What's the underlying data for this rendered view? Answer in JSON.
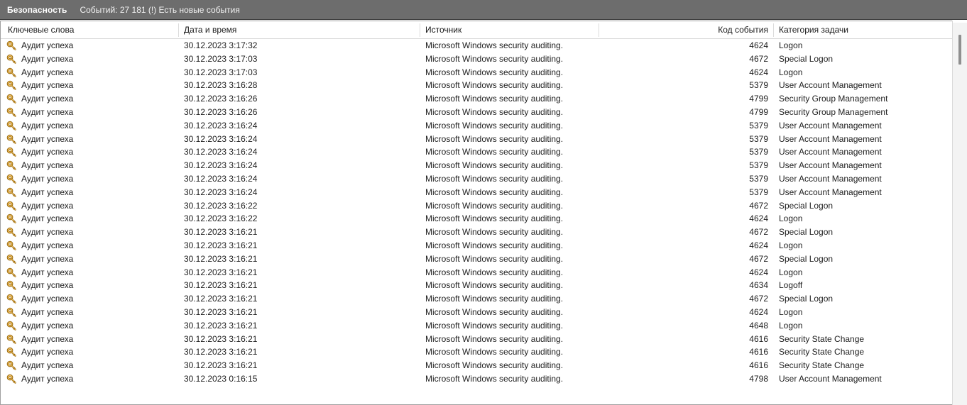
{
  "titlebar": {
    "log_name": "Безопасность",
    "status": "Событий: 27 181 (!) Есть новые события"
  },
  "columns": [
    {
      "key": "keywords",
      "label": "Ключевые слова",
      "align": "left"
    },
    {
      "key": "datetime",
      "label": "Дата и время",
      "align": "left"
    },
    {
      "key": "source",
      "label": "Источник",
      "align": "left"
    },
    {
      "key": "event_id",
      "label": "Код события",
      "align": "right"
    },
    {
      "key": "task_category",
      "label": "Категория задачи",
      "align": "left"
    }
  ],
  "icons": {
    "row_icon": "key-icon",
    "row_icon_color": "#e8a317"
  },
  "colors": {
    "titlebar_bg": "#6d6d6d",
    "titlebar_text": "#ffffff",
    "row_text": "#1d1d1d",
    "grid_line": "#d9d9d9",
    "scrollbar_track": "#f3f3f3",
    "scrollbar_thumb": "#8f8f8f"
  },
  "scrollbar": {
    "orientation": "vertical",
    "thumb_position_percent": 3
  },
  "rows": [
    {
      "keywords": "Аудит успеха",
      "datetime": "30.12.2023 3:17:32",
      "source": "Microsoft Windows security auditing.",
      "event_id": "4624",
      "task_category": "Logon"
    },
    {
      "keywords": "Аудит успеха",
      "datetime": "30.12.2023 3:17:03",
      "source": "Microsoft Windows security auditing.",
      "event_id": "4672",
      "task_category": "Special Logon"
    },
    {
      "keywords": "Аудит успеха",
      "datetime": "30.12.2023 3:17:03",
      "source": "Microsoft Windows security auditing.",
      "event_id": "4624",
      "task_category": "Logon"
    },
    {
      "keywords": "Аудит успеха",
      "datetime": "30.12.2023 3:16:28",
      "source": "Microsoft Windows security auditing.",
      "event_id": "5379",
      "task_category": "User Account Management"
    },
    {
      "keywords": "Аудит успеха",
      "datetime": "30.12.2023 3:16:26",
      "source": "Microsoft Windows security auditing.",
      "event_id": "4799",
      "task_category": "Security Group Management"
    },
    {
      "keywords": "Аудит успеха",
      "datetime": "30.12.2023 3:16:26",
      "source": "Microsoft Windows security auditing.",
      "event_id": "4799",
      "task_category": "Security Group Management"
    },
    {
      "keywords": "Аудит успеха",
      "datetime": "30.12.2023 3:16:24",
      "source": "Microsoft Windows security auditing.",
      "event_id": "5379",
      "task_category": "User Account Management"
    },
    {
      "keywords": "Аудит успеха",
      "datetime": "30.12.2023 3:16:24",
      "source": "Microsoft Windows security auditing.",
      "event_id": "5379",
      "task_category": "User Account Management"
    },
    {
      "keywords": "Аудит успеха",
      "datetime": "30.12.2023 3:16:24",
      "source": "Microsoft Windows security auditing.",
      "event_id": "5379",
      "task_category": "User Account Management"
    },
    {
      "keywords": "Аудит успеха",
      "datetime": "30.12.2023 3:16:24",
      "source": "Microsoft Windows security auditing.",
      "event_id": "5379",
      "task_category": "User Account Management"
    },
    {
      "keywords": "Аудит успеха",
      "datetime": "30.12.2023 3:16:24",
      "source": "Microsoft Windows security auditing.",
      "event_id": "5379",
      "task_category": "User Account Management"
    },
    {
      "keywords": "Аудит успеха",
      "datetime": "30.12.2023 3:16:24",
      "source": "Microsoft Windows security auditing.",
      "event_id": "5379",
      "task_category": "User Account Management"
    },
    {
      "keywords": "Аудит успеха",
      "datetime": "30.12.2023 3:16:22",
      "source": "Microsoft Windows security auditing.",
      "event_id": "4672",
      "task_category": "Special Logon"
    },
    {
      "keywords": "Аудит успеха",
      "datetime": "30.12.2023 3:16:22",
      "source": "Microsoft Windows security auditing.",
      "event_id": "4624",
      "task_category": "Logon"
    },
    {
      "keywords": "Аудит успеха",
      "datetime": "30.12.2023 3:16:21",
      "source": "Microsoft Windows security auditing.",
      "event_id": "4672",
      "task_category": "Special Logon"
    },
    {
      "keywords": "Аудит успеха",
      "datetime": "30.12.2023 3:16:21",
      "source": "Microsoft Windows security auditing.",
      "event_id": "4624",
      "task_category": "Logon"
    },
    {
      "keywords": "Аудит успеха",
      "datetime": "30.12.2023 3:16:21",
      "source": "Microsoft Windows security auditing.",
      "event_id": "4672",
      "task_category": "Special Logon"
    },
    {
      "keywords": "Аудит успеха",
      "datetime": "30.12.2023 3:16:21",
      "source": "Microsoft Windows security auditing.",
      "event_id": "4624",
      "task_category": "Logon"
    },
    {
      "keywords": "Аудит успеха",
      "datetime": "30.12.2023 3:16:21",
      "source": "Microsoft Windows security auditing.",
      "event_id": "4634",
      "task_category": "Logoff"
    },
    {
      "keywords": "Аудит успеха",
      "datetime": "30.12.2023 3:16:21",
      "source": "Microsoft Windows security auditing.",
      "event_id": "4672",
      "task_category": "Special Logon"
    },
    {
      "keywords": "Аудит успеха",
      "datetime": "30.12.2023 3:16:21",
      "source": "Microsoft Windows security auditing.",
      "event_id": "4624",
      "task_category": "Logon"
    },
    {
      "keywords": "Аудит успеха",
      "datetime": "30.12.2023 3:16:21",
      "source": "Microsoft Windows security auditing.",
      "event_id": "4648",
      "task_category": "Logon"
    },
    {
      "keywords": "Аудит успеха",
      "datetime": "30.12.2023 3:16:21",
      "source": "Microsoft Windows security auditing.",
      "event_id": "4616",
      "task_category": "Security State Change"
    },
    {
      "keywords": "Аудит успеха",
      "datetime": "30.12.2023 3:16:21",
      "source": "Microsoft Windows security auditing.",
      "event_id": "4616",
      "task_category": "Security State Change"
    },
    {
      "keywords": "Аудит успеха",
      "datetime": "30.12.2023 3:16:21",
      "source": "Microsoft Windows security auditing.",
      "event_id": "4616",
      "task_category": "Security State Change"
    },
    {
      "keywords": "Аудит успеха",
      "datetime": "30.12.2023 0:16:15",
      "source": "Microsoft Windows security auditing.",
      "event_id": "4798",
      "task_category": "User Account Management"
    }
  ]
}
